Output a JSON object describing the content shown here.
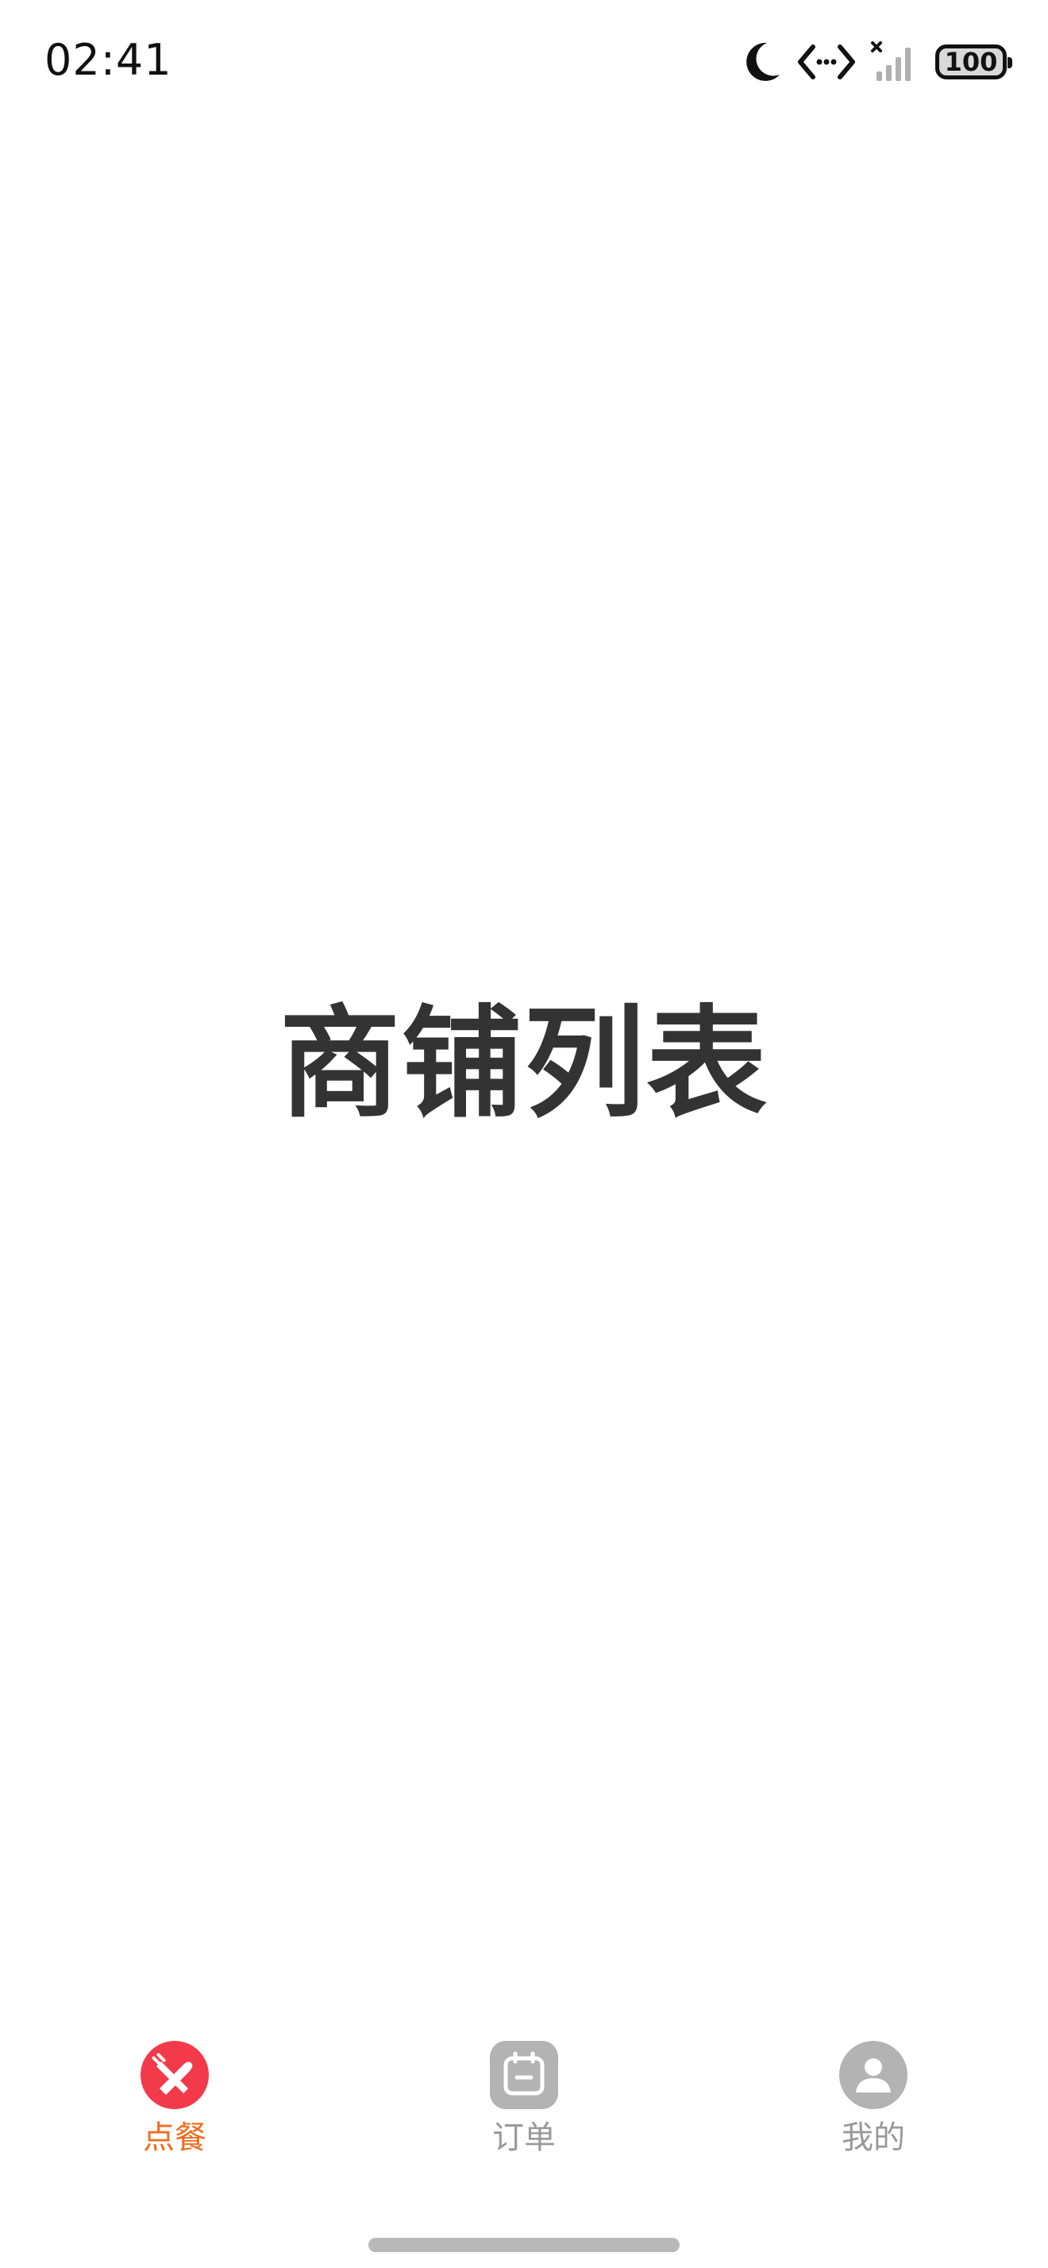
{
  "status_bar": {
    "time": "02:41",
    "battery": "100",
    "icons": [
      "moon-icon",
      "data-transfer-icon",
      "signal-icon",
      "battery-icon"
    ]
  },
  "main": {
    "title": "商铺列表"
  },
  "tabs": [
    {
      "label": "点餐",
      "icon": "utensils-icon",
      "active": true,
      "color": "#f26b1d",
      "icon_bg": "#f23a4b"
    },
    {
      "label": "订单",
      "icon": "order-icon",
      "active": false,
      "color": "#999999",
      "icon_bg": "#b3b3b3"
    },
    {
      "label": "我的",
      "icon": "user-icon",
      "active": false,
      "color": "#999999",
      "icon_bg": "#b3b3b3"
    }
  ]
}
